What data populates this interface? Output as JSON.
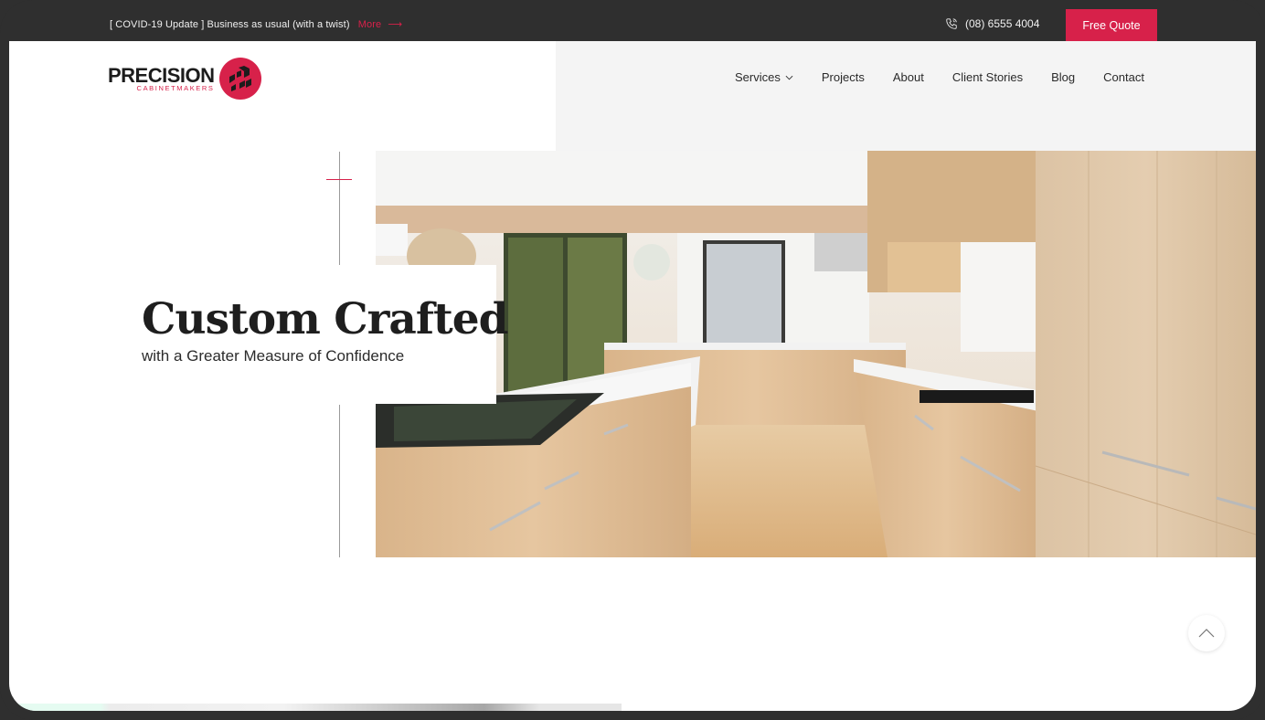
{
  "topbar": {
    "notice_tag": "[ COVID-19 Update ]",
    "notice_text": "Business as usual (with a twist)",
    "more_label": "More",
    "more_arrow": "⟶",
    "phone_icon": "phone-icon",
    "phone_number": "(08) 6555 4004",
    "cta_label": "Free Quote"
  },
  "brand": {
    "name": "PRECISION",
    "tagline": "CABINETMAKERS",
    "accent_color": "#d7214a"
  },
  "nav": {
    "items": [
      {
        "label": "Services",
        "has_dropdown": true
      },
      {
        "label": "Projects"
      },
      {
        "label": "About"
      },
      {
        "label": "Client Stories"
      },
      {
        "label": "Blog"
      },
      {
        "label": "Contact"
      }
    ]
  },
  "hero": {
    "title": "Custom Crafted",
    "subtitle": "with a Greater Measure of Confidence",
    "image_alt": "Modern kitchen with light timber cabinetry and white benchtops"
  },
  "scroll_top": {
    "icon": "chevron-up-icon"
  }
}
